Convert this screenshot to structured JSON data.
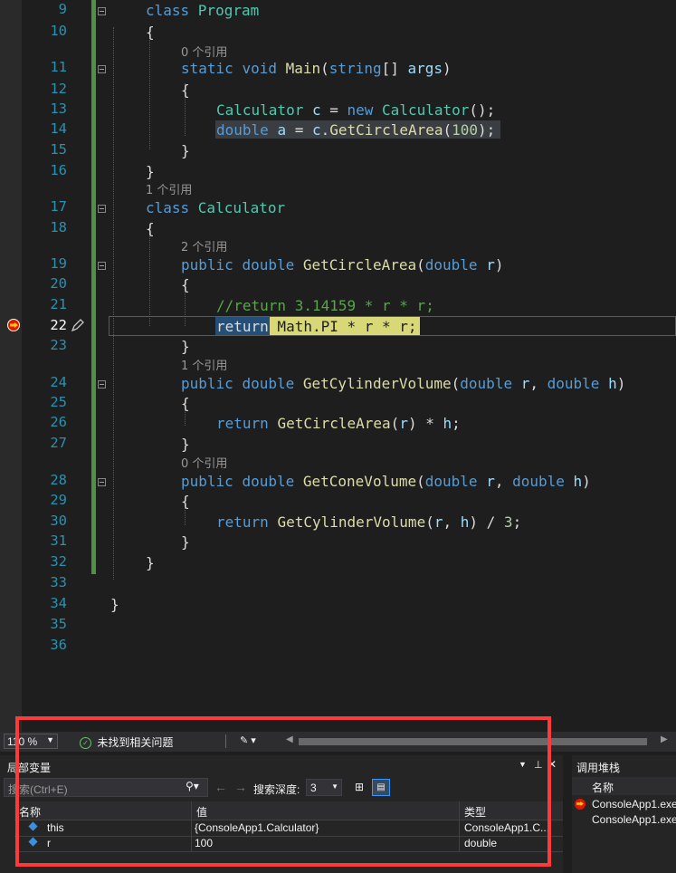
{
  "editor": {
    "line_numbers": [
      "9",
      "10",
      "11",
      "12",
      "13",
      "14",
      "15",
      "16",
      "17",
      "18",
      "19",
      "20",
      "21",
      "22",
      "23",
      "24",
      "25",
      "26",
      "27",
      "28",
      "29",
      "30",
      "31",
      "32",
      "33",
      "34",
      "35",
      "36"
    ],
    "code_lines": [
      {
        "tokens": [
          {
            "t": "class ",
            "c": "kw"
          },
          {
            "t": "Program",
            "c": "ty"
          }
        ]
      },
      {
        "tokens": [
          {
            "t": "{",
            "c": "tx"
          }
        ]
      },
      {
        "tokens": [
          {
            "t": "static ",
            "c": "kw"
          },
          {
            "t": "void ",
            "c": "kw"
          },
          {
            "t": "Main",
            "c": "fn"
          },
          {
            "t": "(",
            "c": "tx"
          },
          {
            "t": "string",
            "c": "kw"
          },
          {
            "t": "[] ",
            "c": "tx"
          },
          {
            "t": "args",
            "c": "pr"
          },
          {
            "t": ")",
            "c": "tx"
          }
        ]
      },
      {
        "tokens": [
          {
            "t": "{",
            "c": "tx"
          }
        ]
      },
      {
        "tokens": [
          {
            "t": "Calculator ",
            "c": "ty"
          },
          {
            "t": "c",
            "c": "pr"
          },
          {
            "t": " = ",
            "c": "tx"
          },
          {
            "t": "new ",
            "c": "kw"
          },
          {
            "t": "Calculator",
            "c": "ty"
          },
          {
            "t": "();",
            "c": "tx"
          }
        ]
      },
      {
        "tokens": [
          {
            "t": "double ",
            "c": "kw"
          },
          {
            "t": "a",
            "c": "pr"
          },
          {
            "t": " = ",
            "c": "tx"
          },
          {
            "t": "c",
            "c": "pr"
          },
          {
            "t": ".",
            "c": "tx"
          },
          {
            "t": "GetCircleArea",
            "c": "fn"
          },
          {
            "t": "(",
            "c": "tx"
          },
          {
            "t": "100",
            "c": "nm"
          },
          {
            "t": ");",
            "c": "tx"
          }
        ]
      },
      {
        "tokens": [
          {
            "t": "}",
            "c": "tx"
          }
        ]
      },
      {
        "tokens": [
          {
            "t": "}",
            "c": "tx"
          }
        ]
      },
      {
        "tokens": [
          {
            "t": "class ",
            "c": "kw"
          },
          {
            "t": "Calculator",
            "c": "ty"
          }
        ]
      },
      {
        "tokens": [
          {
            "t": "{",
            "c": "tx"
          }
        ]
      },
      {
        "tokens": [
          {
            "t": "public ",
            "c": "kw"
          },
          {
            "t": "double ",
            "c": "kw"
          },
          {
            "t": "GetCircleArea",
            "c": "fn"
          },
          {
            "t": "(",
            "c": "tx"
          },
          {
            "t": "double ",
            "c": "kw"
          },
          {
            "t": "r",
            "c": "pr"
          },
          {
            "t": ")",
            "c": "tx"
          }
        ]
      },
      {
        "tokens": [
          {
            "t": "{",
            "c": "tx"
          }
        ]
      },
      {
        "tokens": [
          {
            "t": "//return 3.14159 * r * r;",
            "c": "cm"
          }
        ]
      },
      {
        "tokens": [
          {
            "t": "return",
            "c": "kw"
          },
          {
            "t": " Math.PI * r * r;",
            "c": "tx"
          }
        ]
      },
      {
        "tokens": [
          {
            "t": "}",
            "c": "tx"
          }
        ]
      },
      {
        "tokens": [
          {
            "t": "public ",
            "c": "kw"
          },
          {
            "t": "double ",
            "c": "kw"
          },
          {
            "t": "GetCylinderVolume",
            "c": "fn"
          },
          {
            "t": "(",
            "c": "tx"
          },
          {
            "t": "double ",
            "c": "kw"
          },
          {
            "t": "r",
            "c": "pr"
          },
          {
            "t": ", ",
            "c": "tx"
          },
          {
            "t": "double ",
            "c": "kw"
          },
          {
            "t": "h",
            "c": "pr"
          },
          {
            "t": ")",
            "c": "tx"
          }
        ]
      },
      {
        "tokens": [
          {
            "t": "{",
            "c": "tx"
          }
        ]
      },
      {
        "tokens": [
          {
            "t": "return ",
            "c": "kw"
          },
          {
            "t": "GetCircleArea",
            "c": "fn"
          },
          {
            "t": "(",
            "c": "tx"
          },
          {
            "t": "r",
            "c": "pr"
          },
          {
            "t": ") * ",
            "c": "tx"
          },
          {
            "t": "h",
            "c": "pr"
          },
          {
            "t": ";",
            "c": "tx"
          }
        ]
      },
      {
        "tokens": [
          {
            "t": "}",
            "c": "tx"
          }
        ]
      },
      {
        "tokens": [
          {
            "t": "public ",
            "c": "kw"
          },
          {
            "t": "double ",
            "c": "kw"
          },
          {
            "t": "GetConeVolume",
            "c": "fn"
          },
          {
            "t": "(",
            "c": "tx"
          },
          {
            "t": "double ",
            "c": "kw"
          },
          {
            "t": "r",
            "c": "pr"
          },
          {
            "t": ", ",
            "c": "tx"
          },
          {
            "t": "double ",
            "c": "kw"
          },
          {
            "t": "h",
            "c": "pr"
          },
          {
            "t": ")",
            "c": "tx"
          }
        ]
      },
      {
        "tokens": [
          {
            "t": "{",
            "c": "tx"
          }
        ]
      },
      {
        "tokens": [
          {
            "t": "return ",
            "c": "kw"
          },
          {
            "t": "GetCylinderVolume",
            "c": "fn"
          },
          {
            "t": "(",
            "c": "tx"
          },
          {
            "t": "r",
            "c": "pr"
          },
          {
            "t": ", ",
            "c": "tx"
          },
          {
            "t": "h",
            "c": "pr"
          },
          {
            "t": ") / ",
            "c": "tx"
          },
          {
            "t": "3",
            "c": "nm"
          },
          {
            "t": ";",
            "c": "tx"
          }
        ]
      },
      {
        "tokens": [
          {
            "t": "}",
            "c": "tx"
          }
        ]
      },
      {
        "tokens": [
          {
            "t": "}",
            "c": "tx"
          }
        ]
      },
      {
        "tokens": []
      },
      {
        "tokens": [
          {
            "t": "}",
            "c": "tx"
          }
        ]
      },
      {
        "tokens": []
      },
      {
        "tokens": []
      }
    ],
    "codelens": [
      "0 个引用",
      "1 个引用",
      "2 个引用",
      "1 个引用",
      "0 个引用"
    ]
  },
  "status_bar": {
    "zoom": "110 %",
    "issues": "未找到相关问题"
  },
  "locals": {
    "title": "局部变量",
    "search_placeholder": "搜索(Ctrl+E)",
    "search_depth_label": "搜索深度:",
    "search_depth_value": "3",
    "columns": [
      "名称",
      "值",
      "类型"
    ],
    "rows": [
      {
        "name": "this",
        "value": "{ConsoleApp1.Calculator}",
        "type": "ConsoleApp1.C..."
      },
      {
        "name": "r",
        "value": "100",
        "type": "double"
      }
    ]
  },
  "callstack": {
    "title": "调用堆栈",
    "column": "名称",
    "rows": [
      "ConsoleApp1.exe",
      "ConsoleApp1.exe"
    ]
  },
  "colors": {
    "annotation_box": "#ff3a3a",
    "change_bar": "#57a64a",
    "exec_highlight": "#d8d878"
  }
}
